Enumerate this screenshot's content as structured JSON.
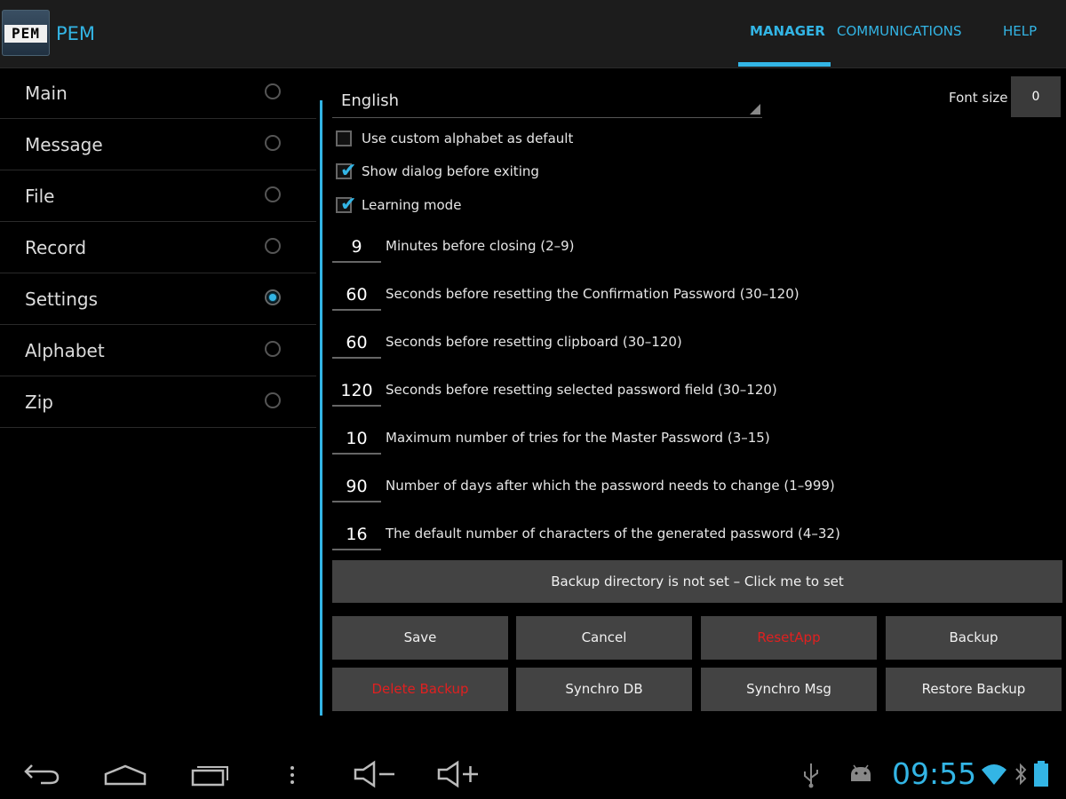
{
  "app": {
    "logo_text": "PEM",
    "title": "PEM"
  },
  "tabs": [
    {
      "label": "MANAGER",
      "active": true
    },
    {
      "label": "COMMUNICATIONS",
      "active": false
    },
    {
      "label": "HELP",
      "active": false
    }
  ],
  "sidebar": {
    "items": [
      {
        "label": "Main",
        "selected": false
      },
      {
        "label": "Message",
        "selected": false
      },
      {
        "label": "File",
        "selected": false
      },
      {
        "label": "Record",
        "selected": false
      },
      {
        "label": "Settings",
        "selected": true
      },
      {
        "label": "Alphabet",
        "selected": false
      },
      {
        "label": "Zip",
        "selected": false
      }
    ]
  },
  "settings": {
    "language": "English",
    "font_size_label": "Font size",
    "font_size_value": "0",
    "checkboxes": [
      {
        "label": "Use custom alphabet as default",
        "checked": false
      },
      {
        "label": "Show dialog before exiting",
        "checked": true
      },
      {
        "label": "Learning mode",
        "checked": true
      }
    ],
    "numeric": [
      {
        "value": "9",
        "label": "Minutes before closing (2–9)"
      },
      {
        "value": "60",
        "label": "Seconds before resetting the Confirmation Password (30–120)"
      },
      {
        "value": "60",
        "label": "Seconds before resetting clipboard (30–120)"
      },
      {
        "value": "120",
        "label": "Seconds before resetting selected password field (30–120)"
      },
      {
        "value": "10",
        "label": "Maximum number of tries for the Master Password (3–15)"
      },
      {
        "value": "90",
        "label": "Number of days after which the password needs to change (1–999)"
      },
      {
        "value": "16",
        "label": "The default number of characters of the generated password (4–32)"
      }
    ],
    "backup_dir_button": "Backup directory is not set – Click me to set",
    "buttons_row1": [
      "Save",
      "Cancel",
      "ResetApp",
      "Backup"
    ],
    "buttons_row2": [
      "Delete Backup",
      "Synchro DB",
      "Synchro Msg",
      "Restore Backup"
    ]
  },
  "system_bar": {
    "clock": "09:55"
  },
  "colors": {
    "accent": "#33b5e5",
    "danger": "#e02020",
    "button_bg": "#434343"
  }
}
